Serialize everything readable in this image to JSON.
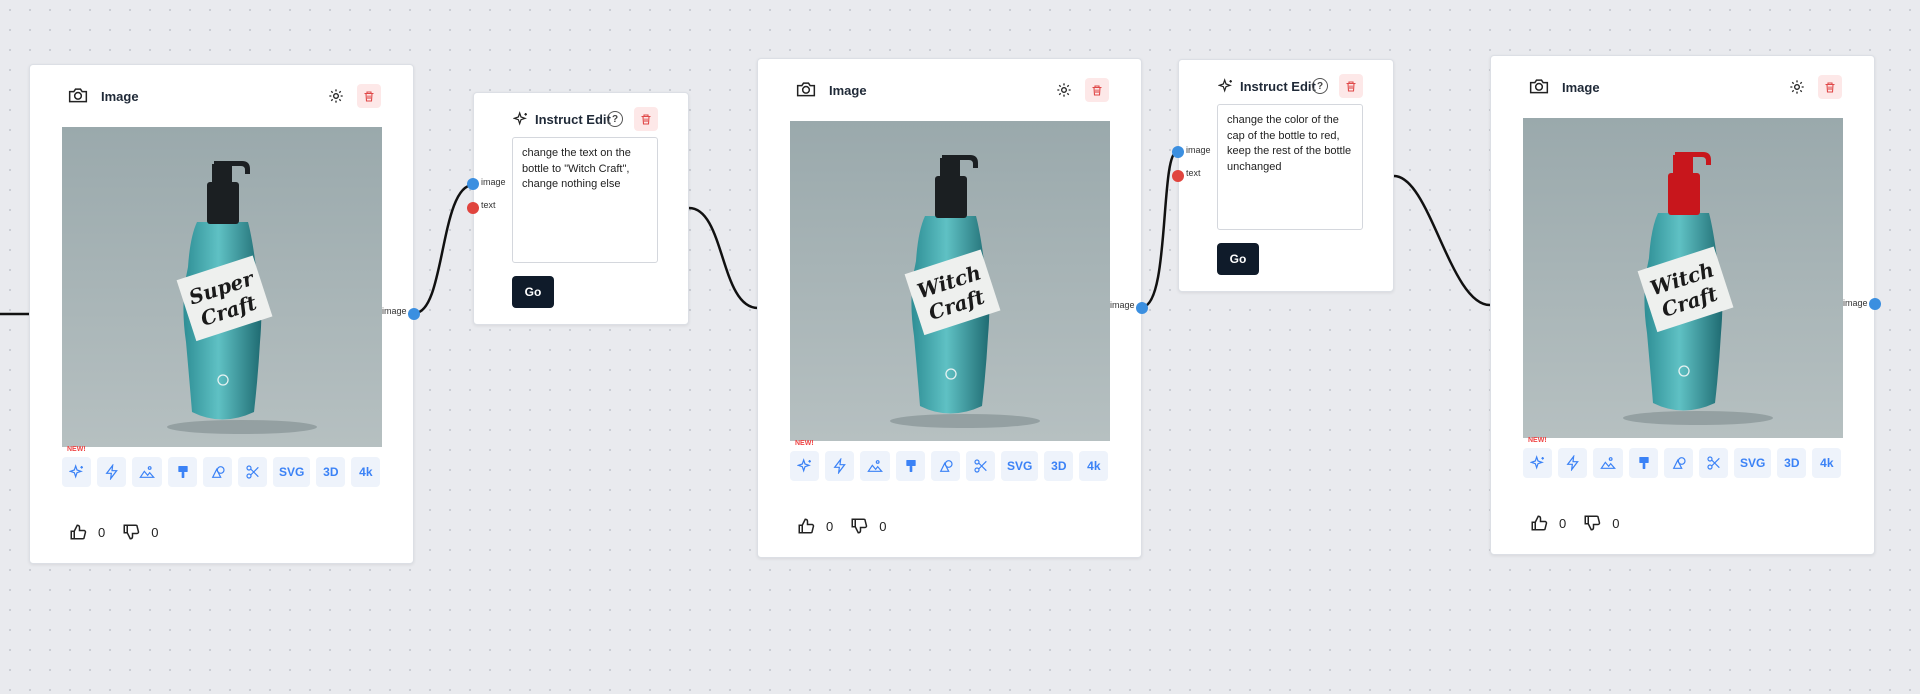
{
  "image_nodes": [
    {
      "title": "Image",
      "bottle_text_line1": "Super",
      "bottle_text_line2": "Craft",
      "cap_color": "#1b1f22",
      "likes": "0",
      "dislikes": "0",
      "output_label": "image"
    },
    {
      "title": "Image",
      "bottle_text_line1": "Witch",
      "bottle_text_line2": "Craft",
      "cap_color": "#1b1f22",
      "likes": "0",
      "dislikes": "0",
      "output_label": "image"
    },
    {
      "title": "Image",
      "bottle_text_line1": "Witch",
      "bottle_text_line2": "Craft",
      "cap_color": "#c8161c",
      "likes": "0",
      "dislikes": "0",
      "output_label": "image"
    }
  ],
  "edit_nodes": [
    {
      "title": "Instruct Edit",
      "help": "?",
      "prompt": "change the text on the bottle to \"Witch Craft\", change nothing else",
      "go_label": "Go",
      "input_image_label": "image",
      "input_text_label": "text"
    },
    {
      "title": "Instruct Edit",
      "help": "?",
      "prompt": "change the color of the cap of the bottle to red, keep the rest of the bottle unchanged",
      "go_label": "Go",
      "input_image_label": "image",
      "input_text_label": "text"
    }
  ],
  "tool_labels": {
    "new_badge": "NEW!",
    "svg": "SVG",
    "three_d": "3D",
    "four_k": "4k"
  },
  "icons": [
    "camera-icon",
    "gear-icon",
    "trash-icon",
    "sparkles-icon",
    "lightning-icon",
    "landscape-icon",
    "brush-icon",
    "shapes-icon",
    "scissors-icon",
    "thumbs-up-icon",
    "thumbs-down-icon",
    "help-icon"
  ],
  "colors": {
    "accent_blue": "#3b82f6",
    "port_blue": "#3b8fe0",
    "port_red": "#e0443e",
    "delete_bg": "#fde8e8",
    "go_button": "#0f1b2a",
    "canvas": "#e9eaee"
  }
}
